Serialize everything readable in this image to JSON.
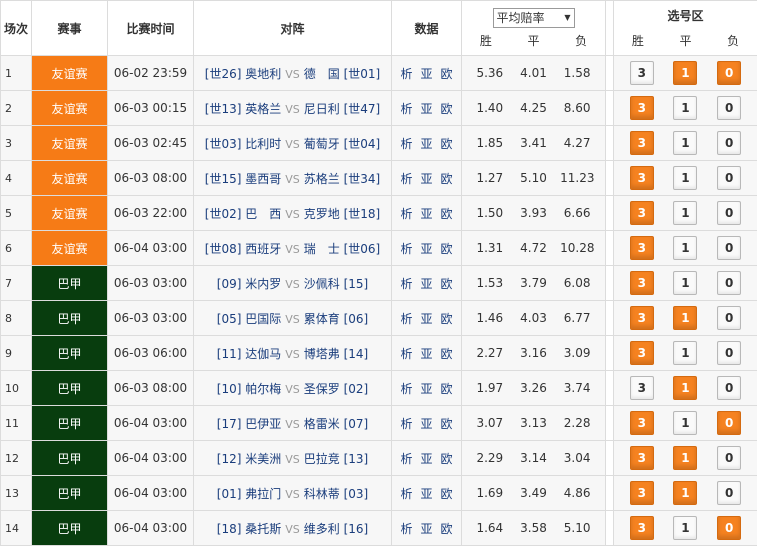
{
  "header": {
    "idx": "场次",
    "league": "赛事",
    "time": "比赛时间",
    "match": "对阵",
    "data": "数据",
    "odds_select": "平均赔率",
    "odds_win": "胜",
    "odds_draw": "平",
    "odds_lose": "负",
    "pick_title": "选号区",
    "pick_win": "胜",
    "pick_draw": "平",
    "pick_lose": "负"
  },
  "data_links": [
    "析",
    "亚",
    "欧"
  ],
  "vs_text": "VS",
  "colors": {
    "friendly": "#f67b16",
    "brazil": "#083d0e",
    "selected": "#f58220"
  },
  "rows": [
    {
      "idx": "1",
      "league": "友谊赛",
      "type": "friendly",
      "time": "06-02 23:59",
      "home": "[世26] 奥地利",
      "away": "德　国 [世01]",
      "w": "5.36",
      "d": "4.01",
      "l": "1.58",
      "sel": [
        false,
        true,
        true
      ]
    },
    {
      "idx": "2",
      "league": "友谊赛",
      "type": "friendly",
      "time": "06-03 00:15",
      "home": "[世13] 英格兰",
      "away": "尼日利 [世47]",
      "w": "1.40",
      "d": "4.25",
      "l": "8.60",
      "sel": [
        true,
        false,
        false
      ]
    },
    {
      "idx": "3",
      "league": "友谊赛",
      "type": "friendly",
      "time": "06-03 02:45",
      "home": "[世03] 比利时",
      "away": "葡萄牙 [世04]",
      "w": "1.85",
      "d": "3.41",
      "l": "4.27",
      "sel": [
        true,
        false,
        false
      ]
    },
    {
      "idx": "4",
      "league": "友谊赛",
      "type": "friendly",
      "time": "06-03 08:00",
      "home": "[世15] 墨西哥",
      "away": "苏格兰 [世34]",
      "w": "1.27",
      "d": "5.10",
      "l": "11.23",
      "sel": [
        true,
        false,
        false
      ]
    },
    {
      "idx": "5",
      "league": "友谊赛",
      "type": "friendly",
      "time": "06-03 22:00",
      "home": "[世02] 巴　西",
      "away": "克罗地 [世18]",
      "w": "1.50",
      "d": "3.93",
      "l": "6.66",
      "sel": [
        true,
        false,
        false
      ]
    },
    {
      "idx": "6",
      "league": "友谊赛",
      "type": "friendly",
      "time": "06-04 03:00",
      "home": "[世08] 西班牙",
      "away": "瑞　士 [世06]",
      "w": "1.31",
      "d": "4.72",
      "l": "10.28",
      "sel": [
        true,
        false,
        false
      ]
    },
    {
      "idx": "7",
      "league": "巴甲",
      "type": "brazil",
      "time": "06-03 03:00",
      "home": "[09] 米内罗",
      "away": "沙佩科 [15]",
      "w": "1.53",
      "d": "3.79",
      "l": "6.08",
      "sel": [
        true,
        false,
        false
      ]
    },
    {
      "idx": "8",
      "league": "巴甲",
      "type": "brazil",
      "time": "06-03 03:00",
      "home": "[05] 巴国际",
      "away": "累体育 [06]",
      "w": "1.46",
      "d": "4.03",
      "l": "6.77",
      "sel": [
        true,
        true,
        false
      ]
    },
    {
      "idx": "9",
      "league": "巴甲",
      "type": "brazil",
      "time": "06-03 06:00",
      "home": "[11] 达伽马",
      "away": "博塔弗 [14]",
      "w": "2.27",
      "d": "3.16",
      "l": "3.09",
      "sel": [
        true,
        false,
        false
      ]
    },
    {
      "idx": "10",
      "league": "巴甲",
      "type": "brazil",
      "time": "06-03 08:00",
      "home": "[10] 帕尔梅",
      "away": "圣保罗 [02]",
      "w": "1.97",
      "d": "3.26",
      "l": "3.74",
      "sel": [
        false,
        true,
        false
      ]
    },
    {
      "idx": "11",
      "league": "巴甲",
      "type": "brazil",
      "time": "06-04 03:00",
      "home": "[17] 巴伊亚",
      "away": "格雷米 [07]",
      "w": "3.07",
      "d": "3.13",
      "l": "2.28",
      "sel": [
        true,
        false,
        true
      ]
    },
    {
      "idx": "12",
      "league": "巴甲",
      "type": "brazil",
      "time": "06-04 03:00",
      "home": "[12] 米美洲",
      "away": "巴拉竞 [13]",
      "w": "2.29",
      "d": "3.14",
      "l": "3.04",
      "sel": [
        true,
        true,
        false
      ]
    },
    {
      "idx": "13",
      "league": "巴甲",
      "type": "brazil",
      "time": "06-04 03:00",
      "home": "[01] 弗拉门",
      "away": "科林蒂 [03]",
      "w": "1.69",
      "d": "3.49",
      "l": "4.86",
      "sel": [
        true,
        true,
        false
      ]
    },
    {
      "idx": "14",
      "league": "巴甲",
      "type": "brazil",
      "time": "06-04 03:00",
      "home": "[18] 桑托斯",
      "away": "维多利 [16]",
      "w": "1.64",
      "d": "3.58",
      "l": "5.10",
      "sel": [
        true,
        false,
        true
      ]
    }
  ],
  "pick_values": [
    "3",
    "1",
    "0"
  ]
}
